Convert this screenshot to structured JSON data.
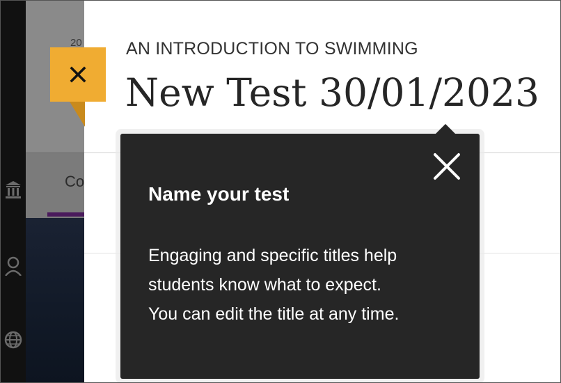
{
  "panel": {
    "course_name": "AN INTRODUCTION TO SWIMMING",
    "test_title": "New Test 30/01/2023",
    "close_icon": "close-icon"
  },
  "background": {
    "year_fragment": "20",
    "tab_fragment": "Co",
    "nav_icons": [
      "institution-icon",
      "user-icon",
      "globe-icon"
    ]
  },
  "tooltip": {
    "heading": "Name your test",
    "body_lines": [
      "Engaging and specific titles help",
      "students know what to expect.",
      "You can edit the title at any time."
    ],
    "close_icon": "close-icon"
  },
  "colors": {
    "accent_close": "#f0ac32",
    "tooltip_bg": "#262626",
    "tab_underline": "#4a1a5c"
  }
}
